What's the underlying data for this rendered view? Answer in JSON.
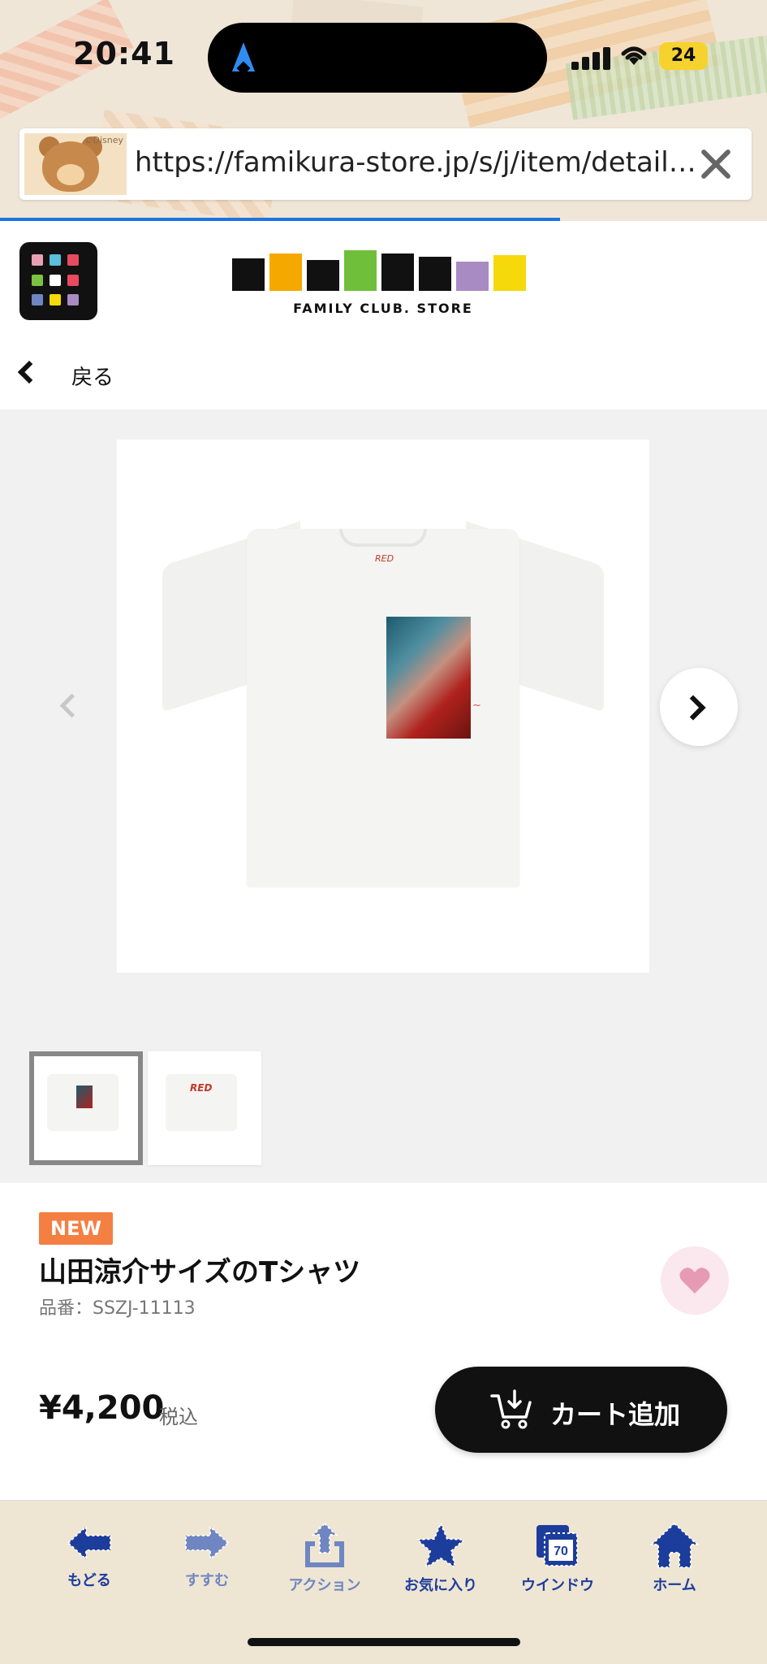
{
  "status": {
    "time": "20:41",
    "battery": "24"
  },
  "browser": {
    "url": "https://famikura-store.jp/s/j/item/detail/…",
    "thumb_caption": "©Disney",
    "load_progress": 0.73
  },
  "site": {
    "logo_sub": "FAMILY CLUB. STORE",
    "back_label": "戻る"
  },
  "product": {
    "badge": "NEW",
    "title": "山田涼介サイズのTシャツ",
    "code": "品番：SSZJ-11113",
    "price": "¥4,200",
    "tax_label": "税込",
    "cart_button": "カート追加",
    "tee_tag": "RED",
    "thumb_back_text": "RED",
    "image_count": 2,
    "selected_image": 1
  },
  "colors": {
    "accent": "#1b74e4",
    "badge": "#f47f43",
    "toolbar_icon": "#1d3d9c",
    "toolbar_icon_muted": "#6f86c2",
    "fav_bg": "#fbe7ee",
    "fav_heart": "#e79ab4"
  },
  "toolbar": {
    "items": [
      {
        "label": "もどる",
        "icon": "back-arrow-icon",
        "enabled": true
      },
      {
        "label": "すすむ",
        "icon": "forward-arrow-icon",
        "enabled": false
      },
      {
        "label": "アクション",
        "icon": "share-icon",
        "enabled": false
      },
      {
        "label": "お気に入り",
        "icon": "star-icon",
        "enabled": true
      },
      {
        "label": "ウインドウ",
        "icon": "windows-icon",
        "enabled": true,
        "count": "70"
      },
      {
        "label": "ホーム",
        "icon": "home-icon",
        "enabled": true
      }
    ]
  }
}
